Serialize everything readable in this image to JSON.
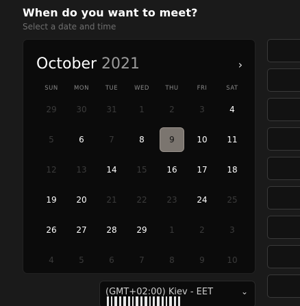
{
  "header": {
    "title": "When do you want to meet?",
    "subtitle": "Select a date and time"
  },
  "calendar": {
    "month": "October",
    "year": "2021",
    "weekdays": [
      "SUN",
      "MON",
      "TUE",
      "WED",
      "THU",
      "FRI",
      "SAT"
    ],
    "days": [
      {
        "label": "29",
        "state": "muted"
      },
      {
        "label": "30",
        "state": "muted"
      },
      {
        "label": "31",
        "state": "muted"
      },
      {
        "label": "1",
        "state": "muted"
      },
      {
        "label": "2",
        "state": "muted"
      },
      {
        "label": "3",
        "state": "muted"
      },
      {
        "label": "4",
        "state": "active"
      },
      {
        "label": "5",
        "state": "muted"
      },
      {
        "label": "6",
        "state": "active"
      },
      {
        "label": "7",
        "state": "muted"
      },
      {
        "label": "8",
        "state": "active"
      },
      {
        "label": "9",
        "state": "selected"
      },
      {
        "label": "10",
        "state": "active"
      },
      {
        "label": "11",
        "state": "active"
      },
      {
        "label": "12",
        "state": "muted"
      },
      {
        "label": "13",
        "state": "muted"
      },
      {
        "label": "14",
        "state": "active"
      },
      {
        "label": "15",
        "state": "muted"
      },
      {
        "label": "16",
        "state": "active"
      },
      {
        "label": "17",
        "state": "active"
      },
      {
        "label": "18",
        "state": "active"
      },
      {
        "label": "19",
        "state": "active"
      },
      {
        "label": "20",
        "state": "active"
      },
      {
        "label": "21",
        "state": "muted"
      },
      {
        "label": "22",
        "state": "muted"
      },
      {
        "label": "23",
        "state": "muted"
      },
      {
        "label": "24",
        "state": "active"
      },
      {
        "label": "25",
        "state": "muted"
      },
      {
        "label": "26",
        "state": "active"
      },
      {
        "label": "27",
        "state": "active"
      },
      {
        "label": "28",
        "state": "active"
      },
      {
        "label": "29",
        "state": "active"
      },
      {
        "label": "1",
        "state": "muted"
      },
      {
        "label": "2",
        "state": "muted"
      },
      {
        "label": "3",
        "state": "muted"
      },
      {
        "label": "4",
        "state": "muted"
      },
      {
        "label": "5",
        "state": "muted"
      },
      {
        "label": "6",
        "state": "muted"
      },
      {
        "label": "7",
        "state": "muted"
      },
      {
        "label": "8",
        "state": "muted"
      },
      {
        "label": "9",
        "state": "muted"
      },
      {
        "label": "10",
        "state": "muted"
      }
    ],
    "next_icon": "chevron-right-icon"
  },
  "timezone": {
    "value": "(GMT+02:00) Kiev - EET",
    "icon": "chevron-down-icon"
  },
  "colors": {
    "background": "#1a1a1a",
    "panel": "#0b0b0b",
    "selected": "#7b756f"
  }
}
